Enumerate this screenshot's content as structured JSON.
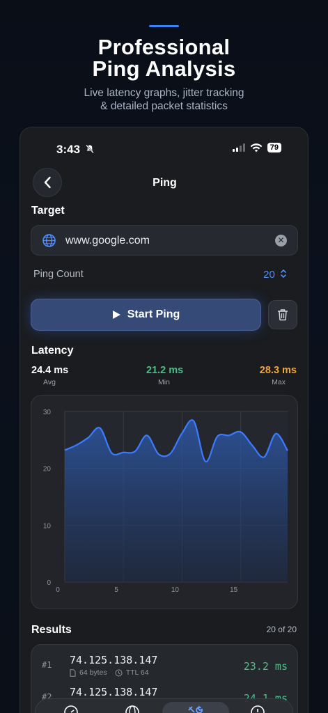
{
  "hero": {
    "title_line1": "Professional",
    "title_line2": "Ping Analysis",
    "subtitle_line1": "Live latency graphs, jitter tracking",
    "subtitle_line2": "& detailed packet statistics"
  },
  "status_bar": {
    "time": "3:43",
    "battery": "79"
  },
  "nav": {
    "title": "Ping"
  },
  "target": {
    "label": "Target",
    "value": "www.google.com",
    "icon": "globe-icon"
  },
  "ping_count": {
    "label": "Ping Count",
    "value": "20"
  },
  "actions": {
    "start_label": "Start Ping"
  },
  "latency": {
    "title": "Latency",
    "avg": {
      "value": "24.4 ms",
      "label": "Avg"
    },
    "min": {
      "value": "21.2 ms",
      "label": "Min"
    },
    "max": {
      "value": "28.3 ms",
      "label": "Max"
    }
  },
  "colors": {
    "accent": "#3b82f6",
    "min": "#4fbf86",
    "max": "#f0a53c",
    "line": "#3b7bff"
  },
  "chart_data": {
    "type": "area",
    "x": [
      0,
      1,
      2,
      3,
      4,
      5,
      6,
      7,
      8,
      9,
      10,
      11,
      12,
      13,
      14,
      15,
      16,
      17,
      18,
      19
    ],
    "values": [
      23.2,
      24.1,
      25.4,
      27.1,
      22.7,
      22.8,
      23.0,
      25.8,
      22.5,
      22.6,
      26.2,
      28.3,
      21.2,
      25.6,
      25.8,
      26.4,
      24.0,
      22.0,
      26.1,
      23.1
    ],
    "xticks": [
      0,
      5,
      10,
      15
    ],
    "yticks": [
      0,
      10,
      20,
      30
    ],
    "xlim": [
      0,
      19
    ],
    "ylim": [
      0,
      30
    ],
    "grid": true
  },
  "results": {
    "title": "Results",
    "count": "20 of 20",
    "rows": [
      {
        "idx": "#1",
        "ip": "74.125.138.147",
        "bytes": "64 bytes",
        "ttl": "TTL 64",
        "ms": "23.2 ms"
      },
      {
        "idx": "#2",
        "ip": "74.125.138.147",
        "ms": "24.1 ms"
      }
    ]
  }
}
